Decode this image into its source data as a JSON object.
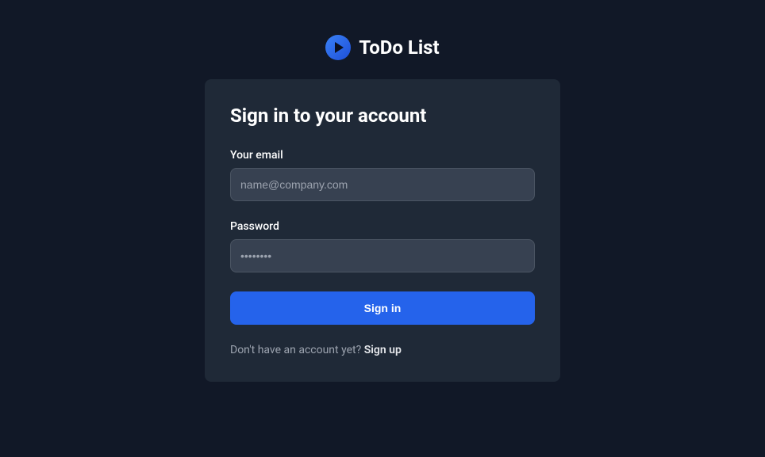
{
  "header": {
    "app_title": "ToDo List"
  },
  "card": {
    "heading": "Sign in to your account",
    "email": {
      "label": "Your email",
      "placeholder": "name@company.com",
      "value": ""
    },
    "password": {
      "label": "Password",
      "placeholder": "••••••••",
      "value": ""
    },
    "signin_label": "Sign in",
    "footer_text": "Don't have an account yet? ",
    "signup_label": "Sign up"
  }
}
